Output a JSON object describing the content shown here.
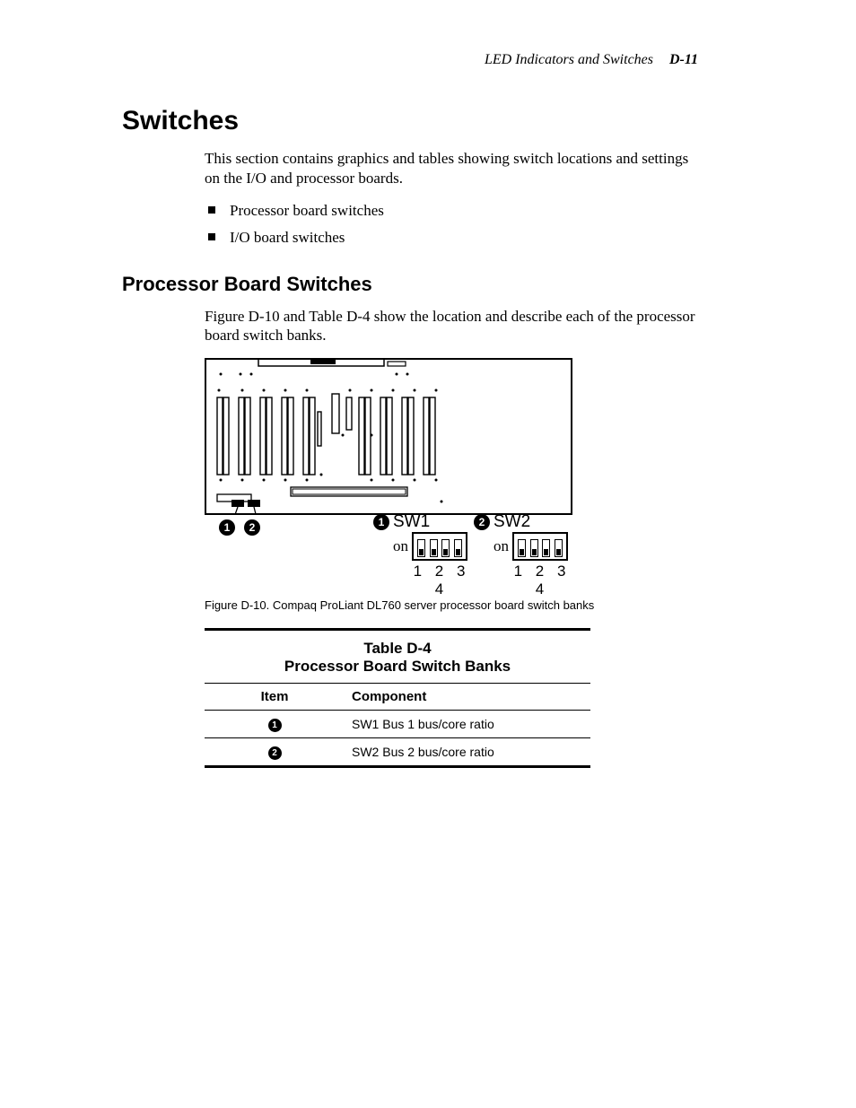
{
  "header": {
    "running_title": "LED Indicators and Switches",
    "page_number": "D-11"
  },
  "section": {
    "title": "Switches",
    "intro": "This section contains graphics and tables showing switch locations and settings on the I/O and processor boards.",
    "bullets": [
      "Processor board switches",
      "I/O board switches"
    ]
  },
  "subsection": {
    "title": "Processor Board Switches",
    "para": "Figure D-10 and Table D-4 show the location and describe each of the processor board switch banks."
  },
  "figure": {
    "callouts": [
      "1",
      "2"
    ],
    "sw1": {
      "marker": "1",
      "label": "SW1",
      "on": "on",
      "numbers": "1 2 3 4"
    },
    "sw2": {
      "marker": "2",
      "label": "SW2",
      "on": "on",
      "numbers": "1 2 3 4"
    },
    "caption": "Figure D-10.  Compaq ProLiant DL760 server processor board switch banks"
  },
  "table": {
    "number": "Table D-4",
    "title": "Processor Board Switch Banks",
    "headers": [
      "Item",
      "Component"
    ],
    "rows": [
      {
        "marker": "1",
        "component": "SW1 Bus 1 bus/core ratio"
      },
      {
        "marker": "2",
        "component": "SW2 Bus 2 bus/core ratio"
      }
    ]
  }
}
